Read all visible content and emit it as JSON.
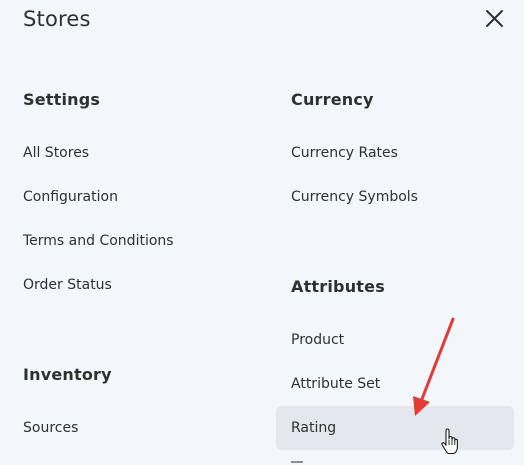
{
  "panel": {
    "title": "Stores",
    "close_icon": "close-icon"
  },
  "settings": {
    "title": "Settings",
    "items": [
      "All Stores",
      "Configuration",
      "Terms and Conditions",
      "Order Status"
    ]
  },
  "inventory": {
    "title": "Inventory",
    "items": [
      "Sources"
    ]
  },
  "currency": {
    "title": "Currency",
    "items": [
      "Currency Rates",
      "Currency Symbols"
    ]
  },
  "attributes": {
    "title": "Attributes",
    "items": [
      "Product",
      "Attribute Set",
      "Rating"
    ],
    "hovered_item": "Rating"
  },
  "annotation": {
    "arrow_color": "#e53935",
    "pointer_icon": "hand-pointer-icon"
  }
}
